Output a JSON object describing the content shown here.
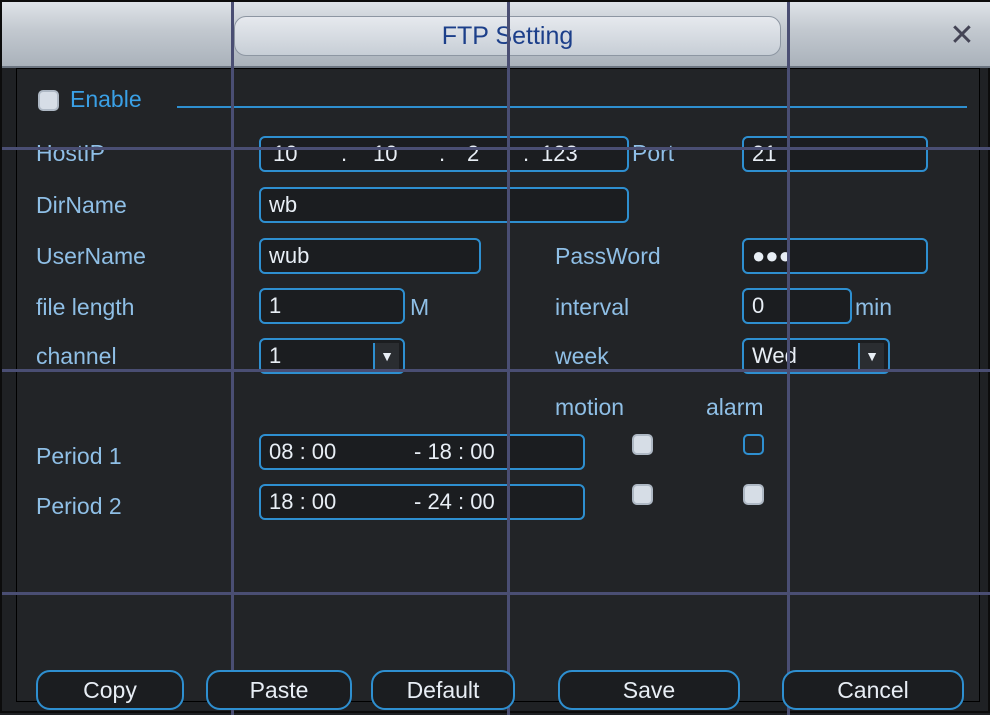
{
  "window": {
    "title": "FTP Setting",
    "close_glyph": "✕"
  },
  "enable": {
    "label": "Enable",
    "checked": true
  },
  "host": {
    "label": "HostIP",
    "ip": [
      "10",
      "10",
      "2",
      "123"
    ],
    "port_label": "Port",
    "port_value": "21"
  },
  "dir": {
    "label": "DirName",
    "value": "wb"
  },
  "user": {
    "label": "UserName",
    "value": "wub",
    "password_label": "PassWord",
    "password_value": "●●●"
  },
  "file": {
    "label": "file length",
    "value": "1",
    "unit": "M",
    "interval_label": "interval",
    "interval_value": "0",
    "interval_unit": "min"
  },
  "channel": {
    "label": "channel",
    "value": "1",
    "week_label": "week",
    "week_value": "Wed"
  },
  "periods_header": {
    "motion": "motion",
    "alarm": "alarm"
  },
  "periods": [
    {
      "label": "Period 1",
      "start": "08 : 00",
      "end": "- 18 : 00",
      "motion": true,
      "alarm": false
    },
    {
      "label": "Period 2",
      "start": "18 : 00",
      "end": "- 24 : 00",
      "motion": true,
      "alarm": true
    }
  ],
  "buttons": {
    "copy": "Copy",
    "paste": "Paste",
    "default": "Default",
    "save": "Save",
    "cancel": "Cancel"
  },
  "colors": {
    "accent": "#2e8fd0",
    "label": "#8fbfe6",
    "background": "#1f2124"
  },
  "icons": {
    "dropdown": "chevron-down-icon",
    "close": "close-icon"
  }
}
